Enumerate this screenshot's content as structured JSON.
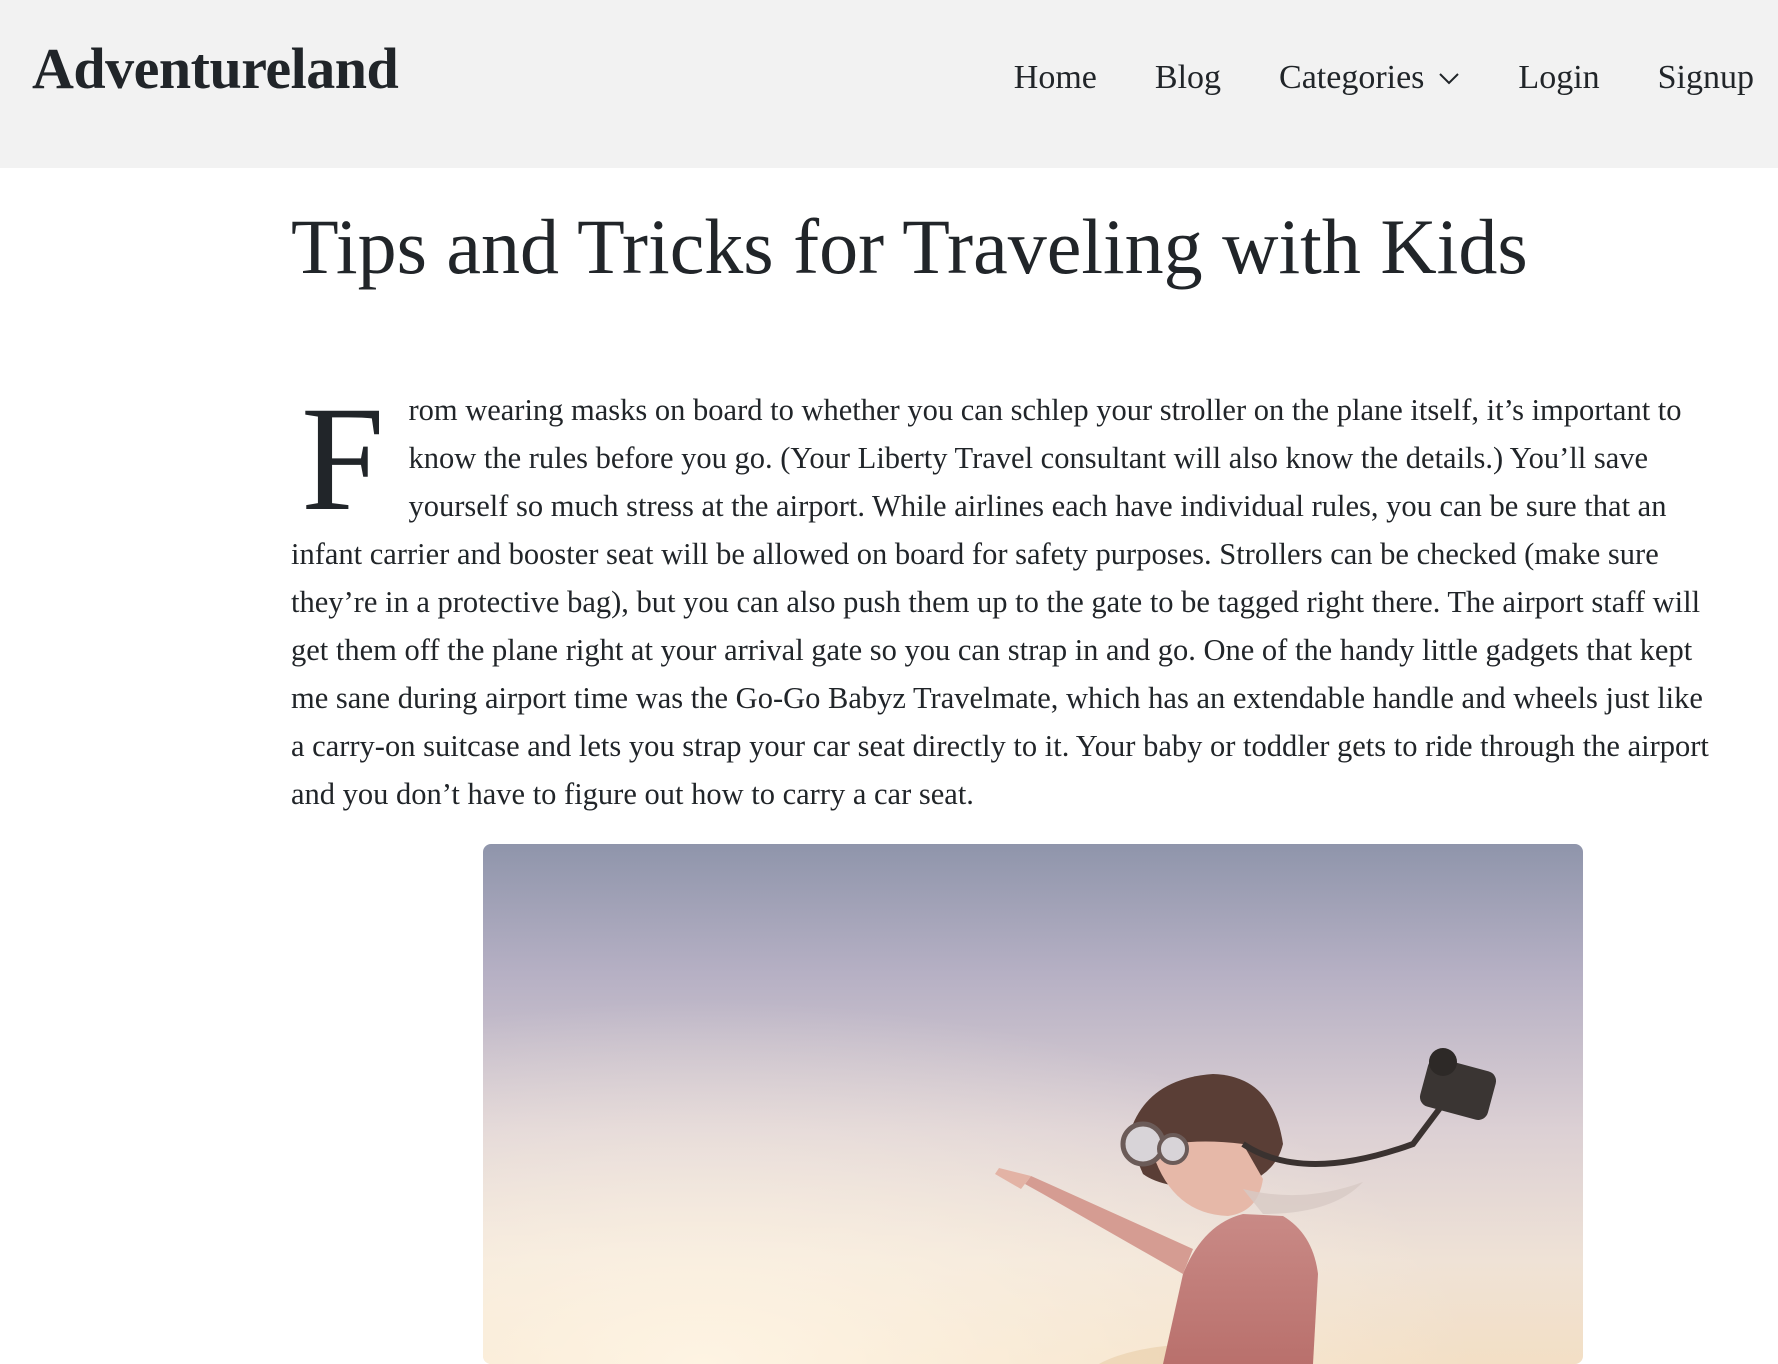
{
  "brand": "Adventureland",
  "nav": {
    "home": "Home",
    "blog": "Blog",
    "categories": "Categories",
    "login": "Login",
    "signup": "Signup"
  },
  "article": {
    "title": "Tips and Tricks for Traveling with Kids",
    "dropcap": "F",
    "body": "rom wearing masks on board to whether you can schlep your stroller on the plane itself, it’s important to know the rules before you go. (Your Liberty Travel consultant will also know the details.) You’ll save yourself so much stress at the airport. While airlines each have individual rules, you can be sure that an infant carrier and booster seat will be allowed on board for safety purposes. Strollers can be checked (make sure they’re in a protective bag), but you can also push them up to the gate to be tagged right there. The airport staff will get them off the plane right at your arrival gate so you can strap in and go. One of the handy little gadgets that kept me sane during airport time was the Go-Go Babyz Travelmate, which has an extendable handle and wheels just like a carry-on suitcase and lets you strap your car seat directly to it. Your baby or toddler gets to ride through the airport and you don’t have to figure out how to carry a car seat."
  },
  "colors": {
    "navbar_bg": "#f2f2f2",
    "text": "#212529"
  },
  "icons": {
    "categories_dropdown": "chevron-down-icon"
  }
}
